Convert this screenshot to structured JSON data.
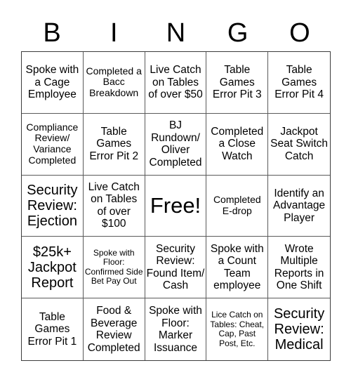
{
  "header": {
    "letters": [
      "B",
      "I",
      "N",
      "G",
      "O"
    ]
  },
  "cells": [
    {
      "text": "Spoke with a Cage Employee",
      "size": "fs-m"
    },
    {
      "text": "Completed a Bacc Breakdown",
      "size": "fs-s"
    },
    {
      "text": "Live Catch on Tables of over $50",
      "size": "fs-m"
    },
    {
      "text": "Table Games Error Pit 3",
      "size": "fs-m"
    },
    {
      "text": "Table Games Error Pit 4",
      "size": "fs-m"
    },
    {
      "text": "Compliance Review/ Variance Completed",
      "size": "fs-s"
    },
    {
      "text": "Table Games Error Pit 2",
      "size": "fs-m"
    },
    {
      "text": "BJ Rundown/ Oliver Completed",
      "size": "fs-m"
    },
    {
      "text": "Completed a Close Watch",
      "size": "fs-m"
    },
    {
      "text": "Jackpot Seat Switch Catch",
      "size": "fs-m"
    },
    {
      "text": "Security Review: Ejection",
      "size": "fs-l"
    },
    {
      "text": "Live Catch on Tables of over $100",
      "size": "fs-m"
    },
    {
      "text": "Free!",
      "size": "fs-xl"
    },
    {
      "text": "Completed E-drop",
      "size": "fs-s"
    },
    {
      "text": "Identify an Advantage Player",
      "size": "fs-m"
    },
    {
      "text": "$25k+ Jackpot Report",
      "size": "fs-l"
    },
    {
      "text": "Spoke with Floor: Confirmed Side Bet Pay Out",
      "size": "fs-xs"
    },
    {
      "text": "Security Review: Found Item/ Cash",
      "size": "fs-m"
    },
    {
      "text": "Spoke with a Count Team employee",
      "size": "fs-m"
    },
    {
      "text": "Wrote Multiple Reports in One Shift",
      "size": "fs-m"
    },
    {
      "text": "Table Games Error Pit 1",
      "size": "fs-m"
    },
    {
      "text": "Food & Beverage Review Completed",
      "size": "fs-m"
    },
    {
      "text": "Spoke with Floor: Marker Issuance",
      "size": "fs-m"
    },
    {
      "text": "Lice Catch on Tables: Cheat, Cap, Past Post, Etc.",
      "size": "fs-xs"
    },
    {
      "text": "Security Review: Medical",
      "size": "fs-l"
    }
  ]
}
